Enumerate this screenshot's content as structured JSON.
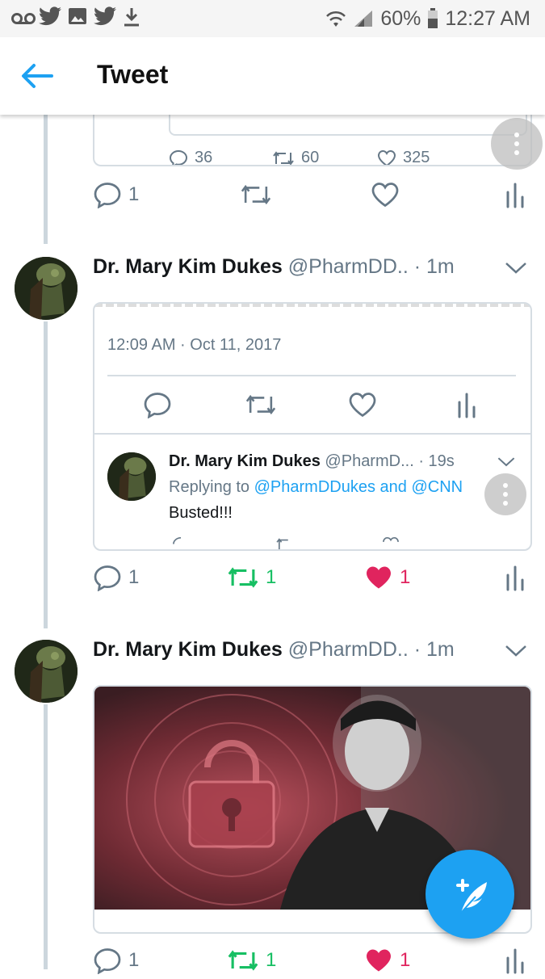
{
  "status_bar": {
    "battery_percent": "60%",
    "time": "12:27 AM",
    "left_icons": [
      "voicemail-icon",
      "twitter-icon",
      "image-icon",
      "twitter-icon",
      "download-icon"
    ],
    "right_icons": [
      "wifi-icon",
      "signal-icon",
      "battery-icon"
    ]
  },
  "app_bar": {
    "title": "Tweet",
    "back_icon": "back-arrow-icon"
  },
  "colors": {
    "accent": "#1da1f2",
    "retweet_active": "#17bf63",
    "like_active": "#e0245e",
    "muted": "#657786"
  },
  "quoted_card_top": {
    "reply_count": "36",
    "retweet_count": "60",
    "like_count": "325"
  },
  "tweet1_actions": {
    "reply_count": "1",
    "retweet_count": "",
    "like_count": ""
  },
  "tweet2": {
    "name": "Dr. Mary Kim Dukes",
    "handle": "@PharmDD..",
    "time": "· 1m",
    "embedded": {
      "timestamp": "12:09 AM · Oct 11, 2017",
      "reply": {
        "name": "Dr. Mary Kim Dukes",
        "handle": "@PharmD...",
        "time": "· 19s",
        "replying_prefix": "Replying to",
        "replying_to_1": "@PharmDDukes",
        "replying_and": "and",
        "replying_to_2": "@CNN",
        "text": "Busted!!!"
      }
    },
    "actions": {
      "reply_count": "1",
      "retweet_count": "1",
      "like_count": "1",
      "retweeted": true,
      "liked": true
    }
  },
  "tweet3": {
    "name": "Dr. Mary Kim Dukes",
    "handle": "@PharmDD..",
    "time": "· 1m",
    "actions": {
      "reply_count": "1",
      "retweet_count": "1",
      "like_count": "1",
      "retweeted": true,
      "liked": true
    }
  },
  "fab": {
    "icon": "compose-tweet-icon"
  }
}
